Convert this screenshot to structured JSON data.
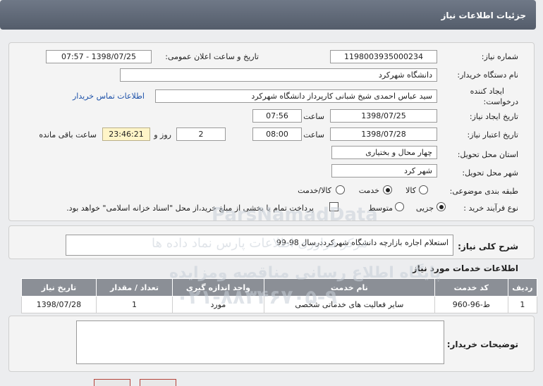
{
  "header": {
    "title": "جزئیات اطلاعات نیاز"
  },
  "fields": {
    "need_number_label": "شماره نیاز:",
    "need_number": "1198003935000234",
    "announce_label": "تاریخ و ساعت اعلان عمومی:",
    "announce_value": "1398/07/25 - 07:57",
    "buyer_org_label": "نام دستگاه خریدار:",
    "buyer_org": "دانشگاه شهرکرد",
    "creator_label_1": "ایجاد کننده",
    "creator_label_2": "درخواست:",
    "creator": "سید عباس احمدی شیخ شبانی کارپرداز دانشگاه شهرکرد",
    "contact_link": "اطلاعات تماس خریدار",
    "created_date_label": "تاریخ ایجاد نیاز:",
    "created_date": "1398/07/25",
    "time_label": "ساعت",
    "created_time": "07:56",
    "valid_date_label": "تاریخ اعتبار نیاز:",
    "valid_date": "1398/07/28",
    "valid_time": "08:00",
    "days_value": "2",
    "days_label": "روز و",
    "remaining_time": "23:46:21",
    "remaining_label": "ساعت باقی مانده",
    "province_label": "استان محل تحویل:",
    "province": "چهار محال و بختیاری",
    "city_label": "شهر محل تحویل:",
    "city": "شهر کرد",
    "category_label": "طبقه بندی موضوعی:",
    "category_options": [
      "کالا",
      "خدمت",
      "کالا/خدمت"
    ],
    "process_label": "نوع فرآیند خرید :",
    "process_options": [
      "جزیی",
      "متوسط"
    ],
    "payment_note": "پرداخت تمام یا بخشی از مبلغ خرید،از محل \"اسناد خزانه اسلامی\" خواهد بود."
  },
  "summary": {
    "label": "شرح کلی نیاز:",
    "value": "استعلام اجاره بازارچه دانشگاه شهرکرددرسال 98-99"
  },
  "services": {
    "title": "اطلاعات خدمات مورد نیاز",
    "headers": [
      "ردیف",
      "کد خدمت",
      "نام خدمت",
      "واحد اندازه گیری",
      "تعداد / مقدار",
      "تاریخ نیاز"
    ],
    "rows": [
      [
        "1",
        "ط-96-960",
        "سایر فعالیت های خدماتی شخصی",
        "مورد",
        "1",
        "1398/07/28"
      ]
    ]
  },
  "buyer_notes": {
    "label": "توضیحات خریدار:",
    "value": ""
  },
  "watermark": {
    "line1": "ParsNamadData",
    "line2": "مرکز فراوری اطلاعات پارس نماد داده ها",
    "line3": "پایگاه اطلاع رسانی مناقصه ومزایده",
    "line4": "۰۲۱-۸۸۳۴۶۷۰۵-۹"
  }
}
